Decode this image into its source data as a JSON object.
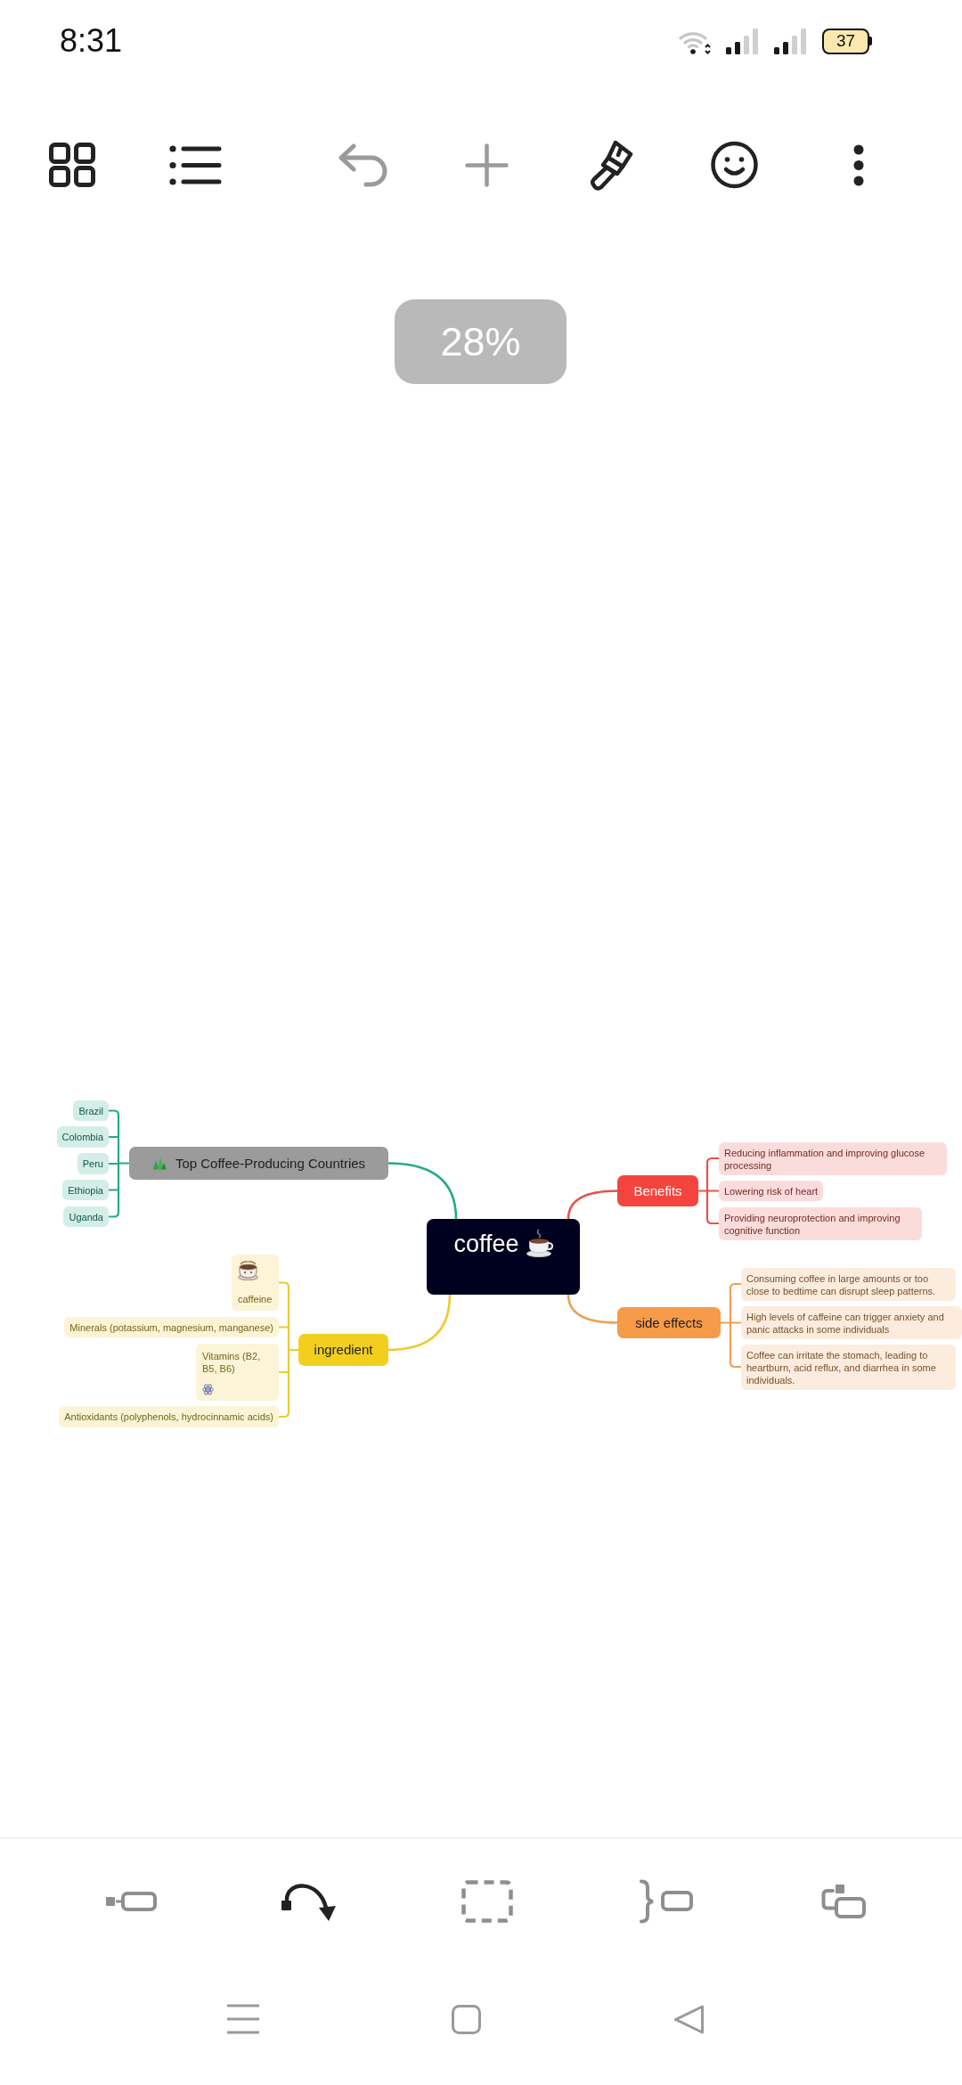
{
  "status_bar": {
    "time": "8:31",
    "battery": "37"
  },
  "toolbar": {
    "items": [
      {
        "kind": "grid",
        "disabled": false
      },
      {
        "kind": "outline",
        "disabled": false
      },
      {
        "kind": "undo",
        "disabled": true
      },
      {
        "kind": "add",
        "disabled": true
      },
      {
        "kind": "brush",
        "disabled": false
      },
      {
        "kind": "sticker",
        "disabled": false
      },
      {
        "kind": "more",
        "disabled": false
      }
    ]
  },
  "zoom_level": "28%",
  "mind_map": {
    "root": {
      "title": "coffee"
    },
    "branches": [
      {
        "color": "#22ab87",
        "topic": {
          "title": "Top Coffee-Producing Countries",
          "color": "#9b9b9b"
        },
        "subtopics": [
          {
            "text": "Brazil"
          },
          {
            "text": "Colombia"
          },
          {
            "text": "Peru"
          },
          {
            "text": "Ethiopia"
          },
          {
            "text": "Uganda"
          }
        ]
      },
      {
        "color": "#ecca34",
        "topic": {
          "title": "ingredient",
          "color": "#f2cf1f"
        },
        "subtopics": [
          {
            "kind": "sticker_top",
            "text": "caffeine"
          },
          {
            "kind": "plain",
            "text": "Minerals (potassium, magnesium, manganese)"
          },
          {
            "kind": "icon_bottom",
            "text": "Vitamins (B2, B5, B6)"
          },
          {
            "kind": "plain",
            "text": "Antioxidants (polyphenols, hydrocinnamic acids)"
          }
        ]
      },
      {
        "color": "#e5534a",
        "topic": {
          "title": "Benefits",
          "color": "#f3453e"
        },
        "subtopics": [
          {
            "text": "Reducing inflammation and improving glucose processing"
          },
          {
            "text": "Lowering risk of heart"
          },
          {
            "text": "Providing neuroprotection and improving cognitive function"
          }
        ]
      },
      {
        "color": "#eea056",
        "topic": {
          "title": "side effects",
          "color": "#f59b4a"
        },
        "subtopics": [
          {
            "text": "Consuming coffee in large amounts or too close to bedtime can disrupt sleep patterns."
          },
          {
            "text": "High levels of caffeine can trigger anxiety and panic attacks in some individuals"
          },
          {
            "text": "Coffee can irritate the stomach, leading to heartburn, acid reflux, and diarrhea in some individuals."
          }
        ]
      }
    ]
  },
  "bottom_toolbar": {
    "items": [
      {
        "kind": "sibling",
        "disabled": true
      },
      {
        "kind": "layout",
        "disabled": false
      },
      {
        "kind": "boundary",
        "disabled": true
      },
      {
        "kind": "summary",
        "disabled": true
      },
      {
        "kind": "subtopic",
        "disabled": true
      }
    ]
  }
}
